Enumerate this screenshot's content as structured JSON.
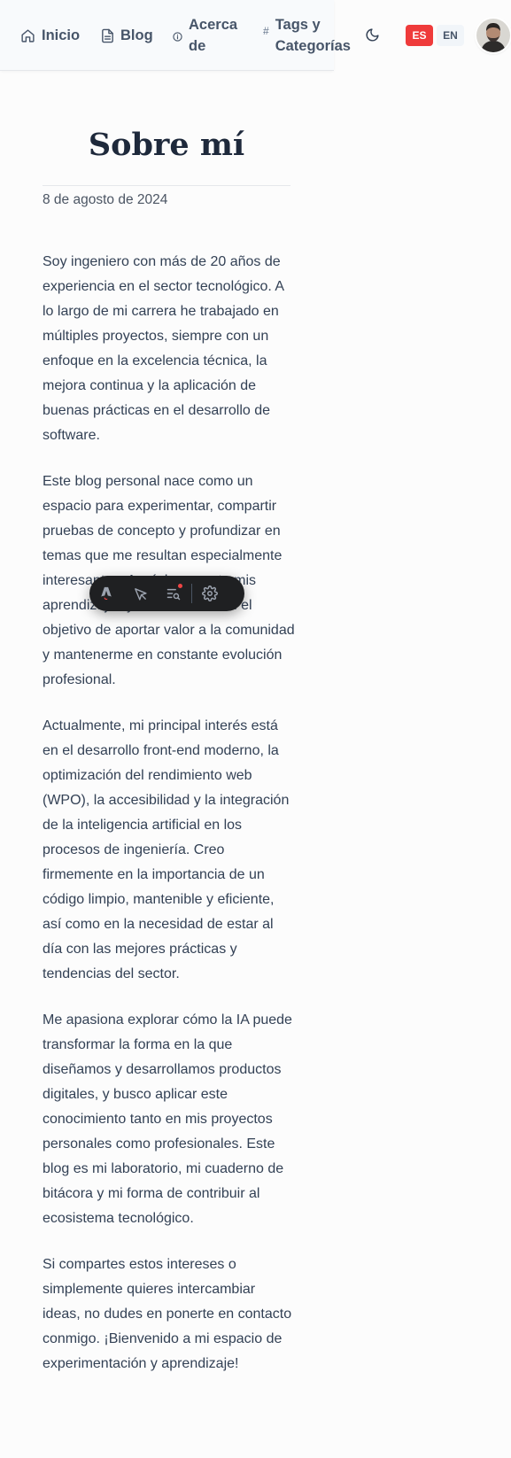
{
  "nav": {
    "items": [
      {
        "label": "Inicio",
        "icon": "home-icon"
      },
      {
        "label": "Blog",
        "icon": "document-icon"
      },
      {
        "label": "Acerca\nde",
        "icon": "info-icon"
      },
      {
        "label": "Tags y\nCategorías",
        "icon": "hash-icon"
      }
    ],
    "theme_icon": "moon-icon",
    "languages": [
      {
        "code": "ES",
        "active": true
      },
      {
        "code": "EN",
        "active": false
      }
    ],
    "avatar_icon": "avatar"
  },
  "article": {
    "title": "Sobre mí",
    "date": "8 de agosto de 2024",
    "paragraphs": [
      "Soy ingeniero con más de 20 años de experiencia en el sector tecnológico. A lo largo de mi carrera he trabajado en múltiples proyectos, siempre con un enfoque en la excelencia técnica, la mejora continua y la aplicación de buenas prácticas en el desarrollo de software.",
      "Este blog personal nace como un espacio para experimentar, compartir pruebas de concepto y profundizar en temas que me resultan especialmente interesantes. Aquí documento mis aprendizajes y reflexiones, con el objetivo de aportar valor a la comunidad y mantenerme en constante evolución profesional.",
      "Actualmente, mi principal interés está en el desarrollo front-end moderno, la optimización del rendimiento web (WPO), la accesibilidad y la integración de la inteligencia artificial en los procesos de ingeniería. Creo firmemente en la importancia de un código limpio, mantenible y eficiente, así como en la necesidad de estar al día con las mejores prácticas y tendencias del sector.",
      "Me apasiona explorar cómo la IA puede transformar la forma en la que diseñamos y desarrollamos productos digitales, y busco aplicar este conocimiento tanto en mis proyectos personales como profesionales. Este blog es mi laboratorio, mi cuaderno de bitácora y mi forma de contribuir al ecosistema tecnológico.",
      "Si compartes estos intereses o simplemente quieres intercambiar ideas, no dudes en ponerte en contacto conmigo. ¡Bienvenido a mi espacio de experimentación y aprendizaje!"
    ]
  },
  "devbar": {
    "buttons": [
      "astro-logo-icon",
      "inspect-cursor-icon",
      "audit-list-icon",
      "settings-gear-icon"
    ],
    "notification": true
  },
  "colors": {
    "accent": "#ef3b3b",
    "nav_text": "#475569",
    "header_bg": "#f8fafc",
    "devbar_bg": "#1f2022"
  }
}
